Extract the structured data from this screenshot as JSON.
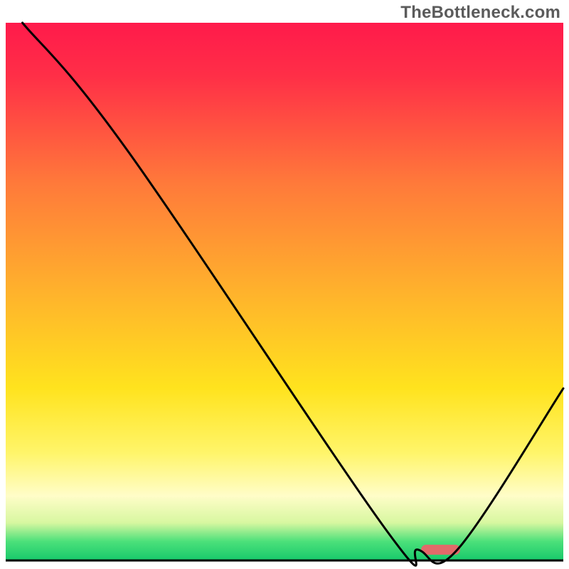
{
  "watermark": "TheBottleneck.com",
  "chart_data": {
    "type": "line",
    "title": "",
    "xlabel": "",
    "ylabel": "",
    "xlim": [
      0,
      1
    ],
    "ylim": [
      0,
      1
    ],
    "background": {
      "gradient_stops": [
        {
          "offset": 0.0,
          "color": "#ff1a4b"
        },
        {
          "offset": 0.1,
          "color": "#ff2f47"
        },
        {
          "offset": 0.3,
          "color": "#ff7a3a"
        },
        {
          "offset": 0.5,
          "color": "#ffb22c"
        },
        {
          "offset": 0.68,
          "color": "#ffe31e"
        },
        {
          "offset": 0.8,
          "color": "#fff56a"
        },
        {
          "offset": 0.88,
          "color": "#fffdc8"
        },
        {
          "offset": 0.93,
          "color": "#d7f7a0"
        },
        {
          "offset": 0.965,
          "color": "#4be07a"
        },
        {
          "offset": 1.0,
          "color": "#17c96b"
        }
      ]
    },
    "series": [
      {
        "name": "bottleneck-curve",
        "color": "#000000",
        "width": 3,
        "points": [
          {
            "x": 0.03,
            "y": 1.0
          },
          {
            "x": 0.22,
            "y": 0.76
          },
          {
            "x": 0.68,
            "y": 0.06
          },
          {
            "x": 0.74,
            "y": 0.02
          },
          {
            "x": 0.81,
            "y": 0.02
          },
          {
            "x": 1.0,
            "y": 0.32
          }
        ]
      }
    ],
    "marker": {
      "name": "optimal-range",
      "x_start": 0.745,
      "x_end": 0.815,
      "y": 0.02,
      "color": "#e26a6a",
      "thickness": 14
    },
    "baseline": {
      "y": 0.0,
      "color": "#000000",
      "width": 3
    }
  }
}
